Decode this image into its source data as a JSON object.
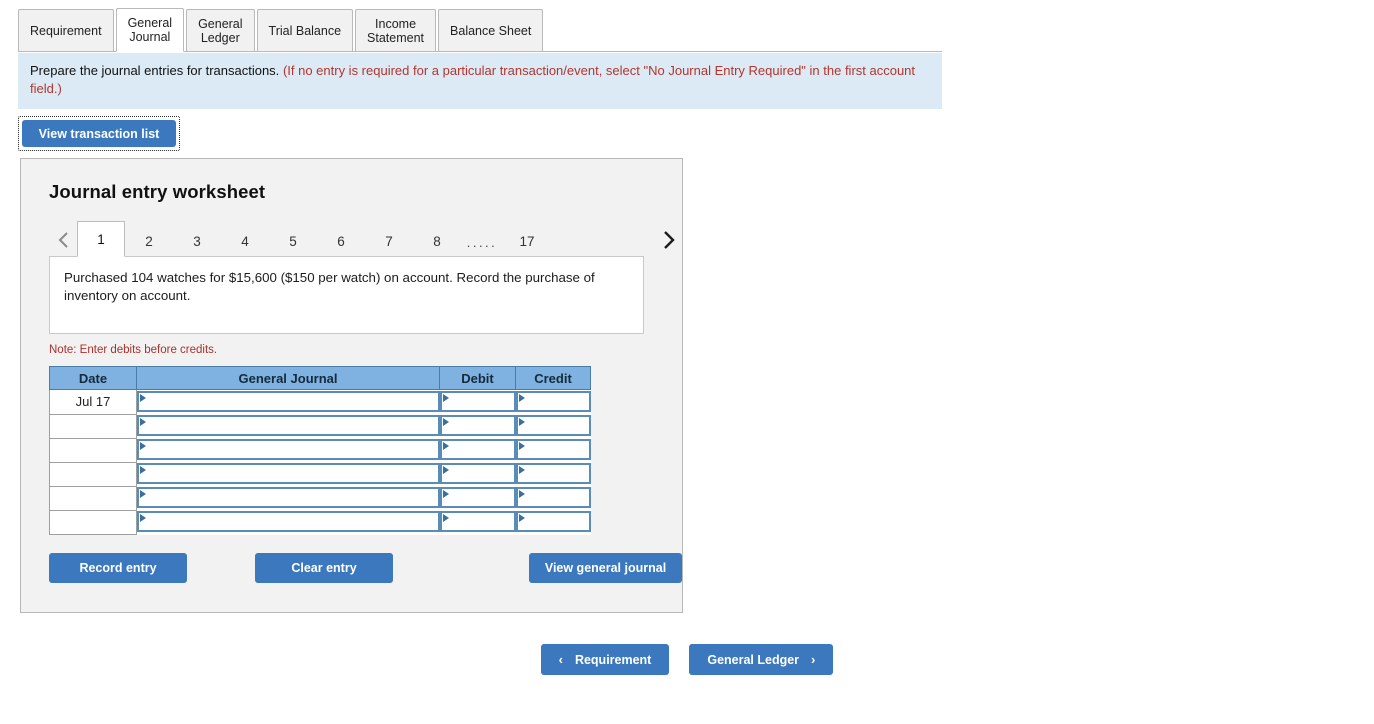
{
  "tabs": [
    {
      "label": "Requirement",
      "active": false
    },
    {
      "label": "General\nJournal",
      "active": true
    },
    {
      "label": "General\nLedger",
      "active": false
    },
    {
      "label": "Trial Balance",
      "active": false
    },
    {
      "label": "Income\nStatement",
      "active": false
    },
    {
      "label": "Balance Sheet",
      "active": false
    }
  ],
  "banner": {
    "main": "Prepare the journal entries for transactions.",
    "note": "(If no entry is required for a particular transaction/event, select \"No Journal Entry Required\" in the first account field.)"
  },
  "toolbar": {
    "view_transaction_list_label": "View transaction list"
  },
  "worksheet": {
    "title": "Journal entry worksheet",
    "pagination": {
      "prev_icon": "chevron-left-icon",
      "next_icon": "chevron-right-icon",
      "pages": [
        "1",
        "2",
        "3",
        "4",
        "5",
        "6",
        "7",
        "8"
      ],
      "ellipsis": ".....",
      "last_page": "17",
      "active_page": "1"
    },
    "transaction_text": "Purchased 104 watches for $15,600 ($150 per watch) on account. Record the purchase of inventory on account.",
    "note": "Note: Enter debits before credits.",
    "table": {
      "columns": [
        "Date",
        "General Journal",
        "Debit",
        "Credit"
      ],
      "rows": [
        {
          "date": "Jul 17",
          "account": "",
          "debit": "",
          "credit": ""
        },
        {
          "date": "",
          "account": "",
          "debit": "",
          "credit": ""
        },
        {
          "date": "",
          "account": "",
          "debit": "",
          "credit": ""
        },
        {
          "date": "",
          "account": "",
          "debit": "",
          "credit": ""
        },
        {
          "date": "",
          "account": "",
          "debit": "",
          "credit": ""
        },
        {
          "date": "",
          "account": "",
          "debit": "",
          "credit": ""
        }
      ]
    },
    "actions": {
      "record_entry": "Record entry",
      "clear_entry": "Clear entry",
      "view_general_journal": "View general journal"
    }
  },
  "bottom_nav": {
    "prev": {
      "label": "Requirement",
      "chevron": "‹"
    },
    "next": {
      "label": "General Ledger",
      "chevron": "›"
    }
  },
  "colors": {
    "accent_button": "#3c78be",
    "table_header": "#7fb2e0",
    "banner_bg": "#dceaf6",
    "note_red": "#a8322c",
    "panel_bg": "#f2f2f2"
  }
}
